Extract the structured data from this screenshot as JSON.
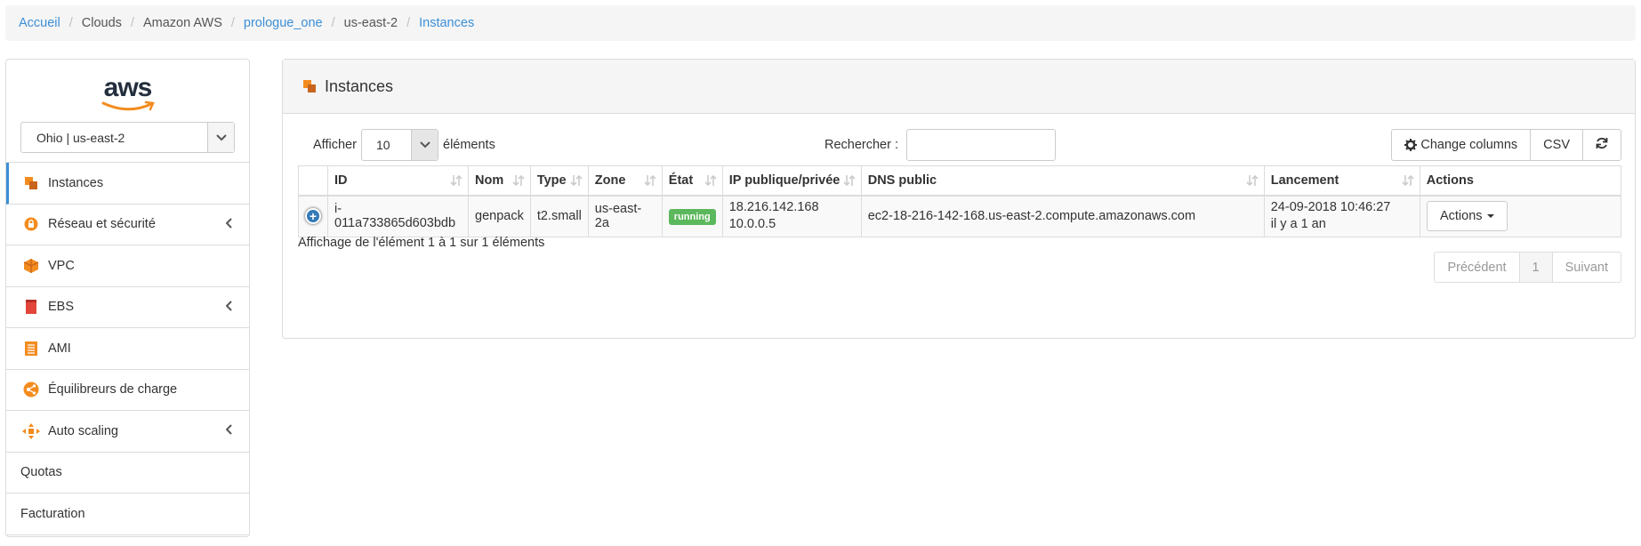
{
  "breadcrumb": {
    "items": [
      "Accueil",
      "Clouds",
      "Amazon AWS",
      "prologue_one",
      "us-east-2",
      "Instances"
    ]
  },
  "sidebar": {
    "logo_text": "aws",
    "region": "Ohio | us-east-2",
    "items": [
      {
        "label": "Instances"
      },
      {
        "label": "Réseau et sécurité"
      },
      {
        "label": "VPC"
      },
      {
        "label": "EBS"
      },
      {
        "label": "AMI"
      },
      {
        "label": "Équilibreurs de charge"
      },
      {
        "label": "Auto scaling"
      },
      {
        "label": "Quotas"
      },
      {
        "label": "Facturation"
      }
    ]
  },
  "panel": {
    "title": "Instances",
    "show_label": "Afficher",
    "page_length": "10",
    "elements_label": "éléments",
    "search_label": "Rechercher :",
    "search_value": "",
    "btn_change_columns": "Change columns",
    "btn_csv": "CSV",
    "columns": [
      "ID",
      "Nom",
      "Type",
      "Zone",
      "État",
      "IP publique/privée",
      "DNS public",
      "Lancement",
      "Actions"
    ],
    "rows": [
      {
        "id": "i-011a733865d603bdb",
        "name": "genpack",
        "type": "t2.small",
        "zone": "us-east-2a",
        "state": "running",
        "ip_public": "18.216.142.168",
        "ip_private": "10.0.0.5",
        "dns": "ec2-18-216-142-168.us-east-2.compute.amazonaws.com",
        "launch_date": "24-09-2018 10:46:27",
        "launch_ago": "il y a 1 an",
        "actions_label": "Actions"
      }
    ],
    "info": "Affichage de l'élément 1 à 1 sur 1 éléments",
    "pager": {
      "prev": "Précédent",
      "page": "1",
      "next": "Suivant"
    }
  },
  "colors": {
    "link": "#3b8fd6",
    "running": "#5cb85c",
    "aws_orange": "#f38c1f"
  }
}
